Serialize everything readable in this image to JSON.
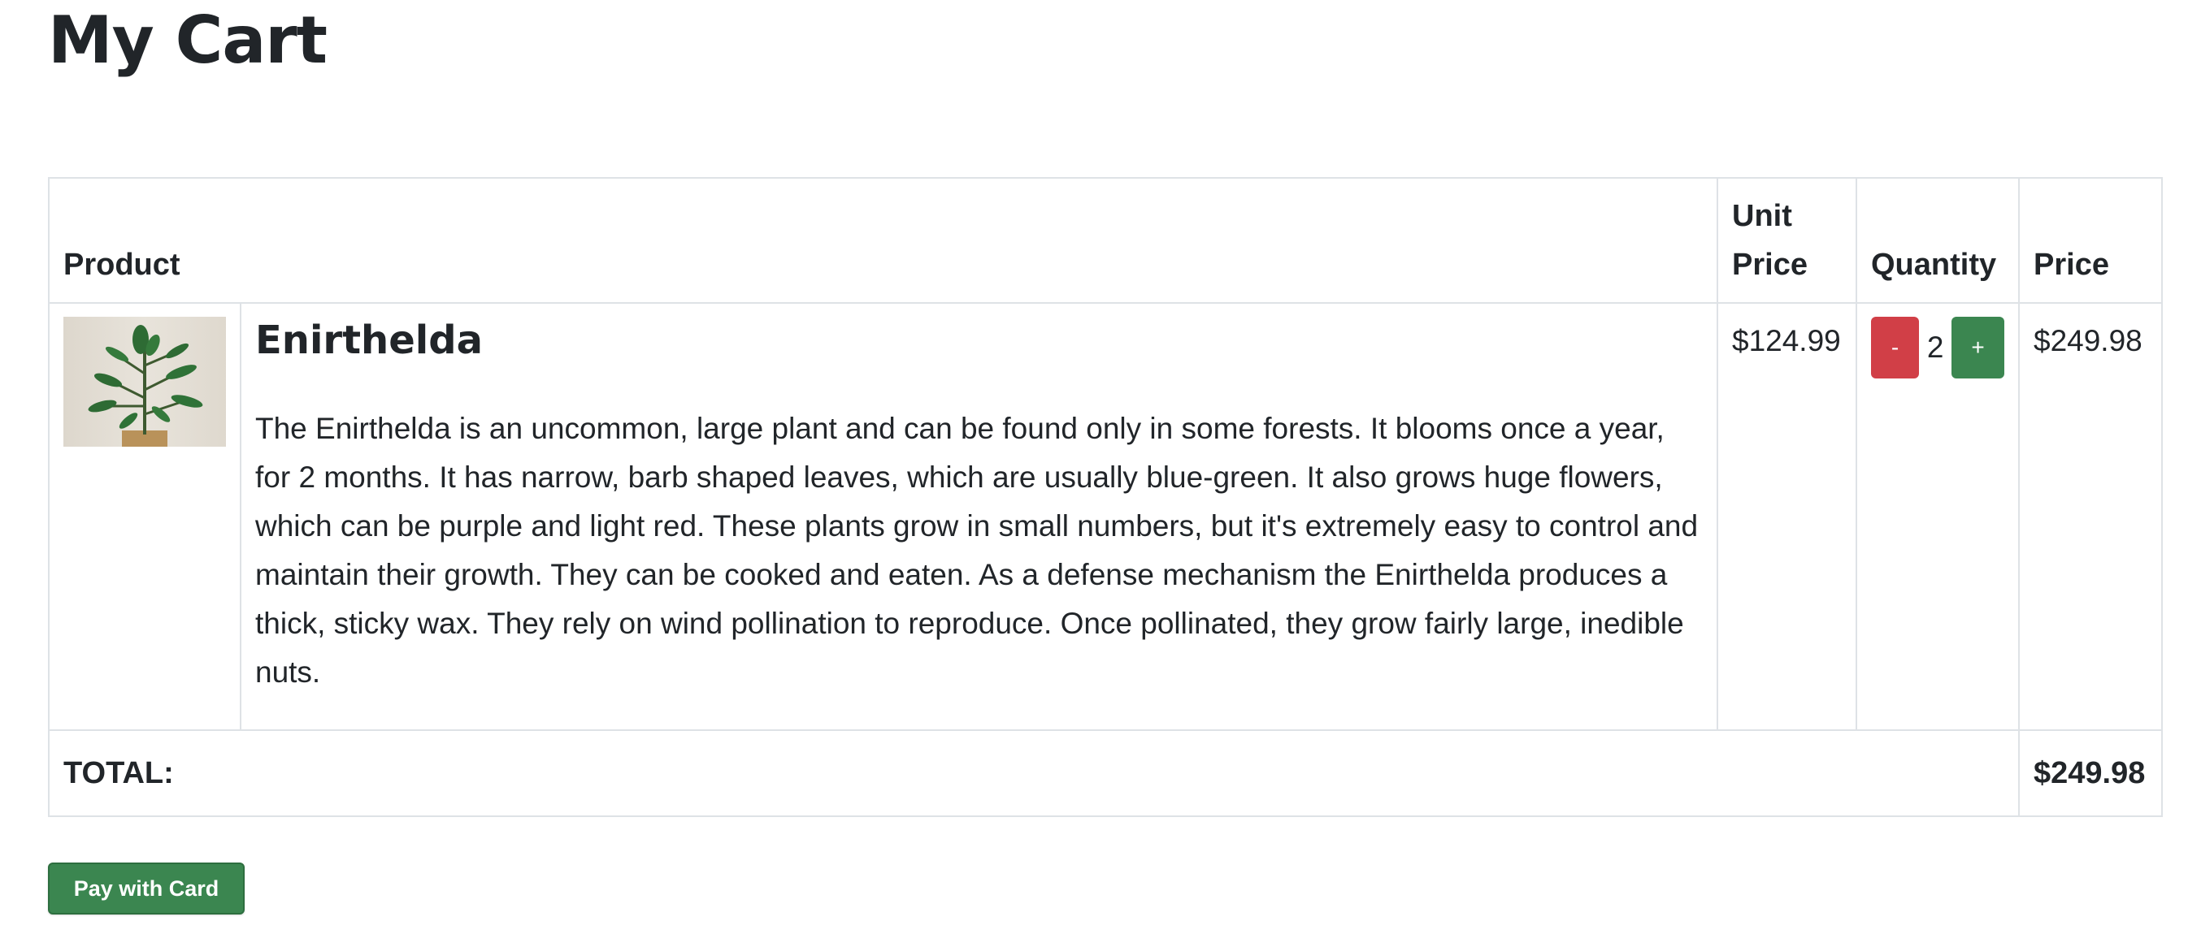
{
  "page": {
    "title": "My Cart"
  },
  "table": {
    "headers": {
      "product": "Product",
      "unit_price": "Unit Price",
      "quantity": "Quantity",
      "price": "Price"
    },
    "items": [
      {
        "name": "Enirthelda",
        "description": "The Enirthelda is an uncommon, large plant and can be found only in some forests. It blooms once a year, for 2 months. It has narrow, barb shaped leaves, which are usually blue-green. It also grows huge flowers, which can be purple and light red. These plants grow in small numbers, but it's extremely easy to control and maintain their growth. They can be cooked and eaten. As a defense mechanism the Enirthelda produces a thick, sticky wax. They rely on wind pollination to reproduce. Once pollinated, they grow fairly large, inedible nuts.",
        "image_icon": "plant-thumbnail",
        "unit_price": "$124.99",
        "quantity": "2",
        "decrement_label": "-",
        "increment_label": "+",
        "price": "$249.98"
      }
    ],
    "total_label": "TOTAL:",
    "total_amount": "$249.98"
  },
  "actions": {
    "pay_label": "Pay with Card"
  },
  "colors": {
    "decrement_button": "#d13f47",
    "increment_button": "#3b8650",
    "pay_button": "#3b8650",
    "border": "#dee2e6"
  }
}
